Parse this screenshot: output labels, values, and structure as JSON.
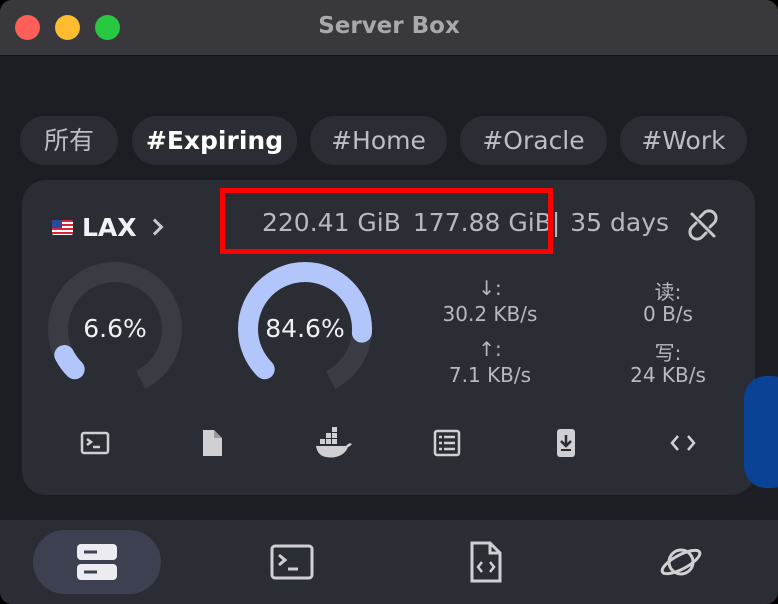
{
  "window": {
    "title": "Server Box"
  },
  "tags": [
    {
      "label": "所有",
      "active": false
    },
    {
      "label": "#Expiring",
      "active": true
    },
    {
      "label": "#Home",
      "active": false
    },
    {
      "label": "#Oracle",
      "active": false
    },
    {
      "label": "#Work",
      "active": false
    }
  ],
  "server": {
    "name": "LAX",
    "flag_icon": "us-flag-icon",
    "traffic_used": "220.41 GiB",
    "traffic_total": "177.88 GiB",
    "separator": "|",
    "expires": "35 days",
    "cpu": {
      "label": "6.6%",
      "value": 0.066
    },
    "memory": {
      "label": "84.6%",
      "value": 0.846
    },
    "net_down": {
      "label": "↓:",
      "value": "30.2 KB/s"
    },
    "net_up": {
      "label": "↑:",
      "value": "7.1 KB/s"
    },
    "disk_read": {
      "label": "读:",
      "value": "0 B/s"
    },
    "disk_write": {
      "label": "写:",
      "value": "24 KB/s"
    },
    "actions": [
      "terminal-icon",
      "file-icon",
      "docker-icon",
      "process-list-icon",
      "download-icon",
      "code-icon"
    ]
  },
  "bottom_nav": [
    {
      "icon": "server-icon",
      "active": true
    },
    {
      "icon": "terminal-icon",
      "active": false
    },
    {
      "icon": "snippet-icon",
      "active": false
    },
    {
      "icon": "planet-icon",
      "active": false
    }
  ],
  "colors": {
    "accent": "#b3c6fb",
    "track": "#3a3c44",
    "highlight": "#ff0000",
    "side_button": "#0a4396"
  }
}
